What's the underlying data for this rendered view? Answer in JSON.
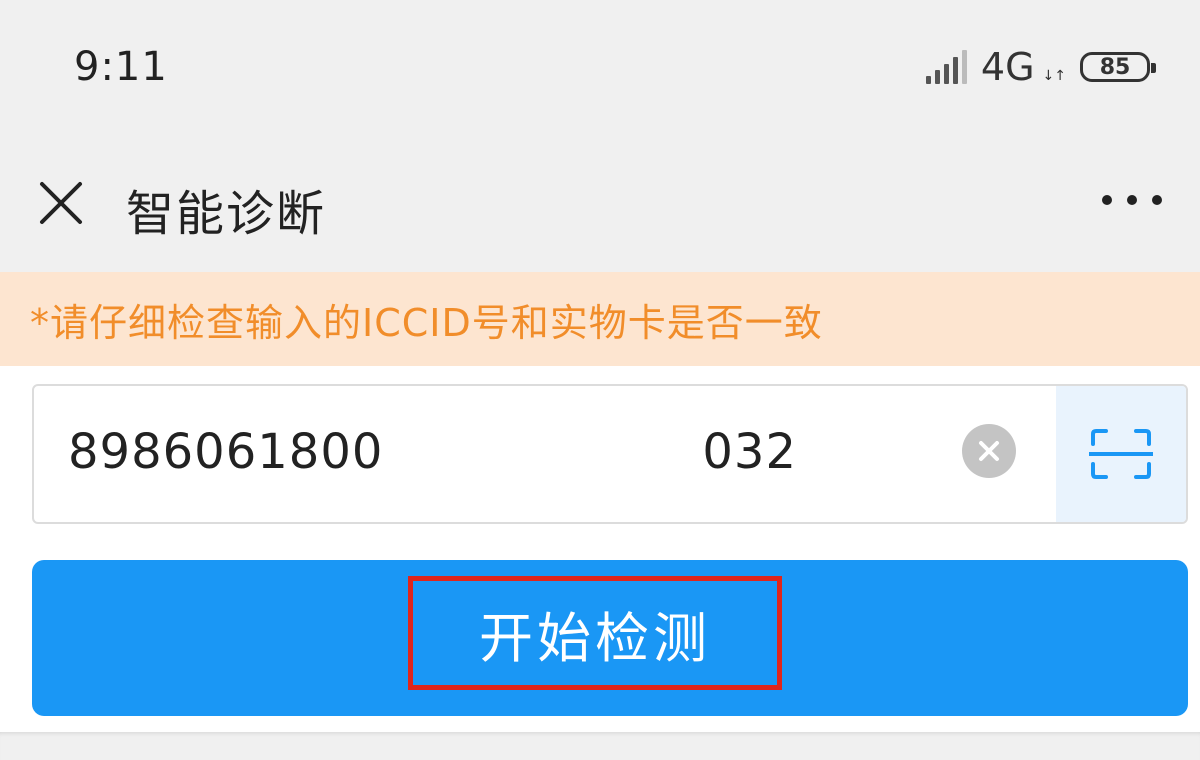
{
  "status_bar": {
    "time": "9:11",
    "network": "4G",
    "data_arrows": "↓↑",
    "battery_level": "85",
    "signal_icon": "signal-icon",
    "battery_icon": "battery-icon"
  },
  "nav_bar": {
    "title": "智能诊断",
    "close_icon": "close-icon",
    "more_icon": "more-icon"
  },
  "warning": {
    "text": "*请仔细检查输入的ICCID号和实物卡是否一致",
    "color": "#f18d2a",
    "background": "#fde5d0"
  },
  "iccid_input": {
    "value": "8986061800       032",
    "clear_icon": "clear-icon",
    "scan_icon": "scan-icon"
  },
  "start_button": {
    "label": "开始检测",
    "color": "#1a97f5",
    "highlight_color": "#e0251b"
  }
}
